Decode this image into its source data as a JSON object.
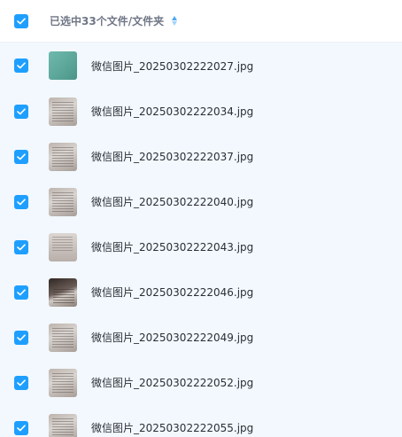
{
  "header": {
    "select_all_checked": true,
    "selection_label": "已选中33个文件/文件夹",
    "sort_icon": "sort-icon"
  },
  "files": [
    {
      "name": "微信图片_20250302222027.jpg",
      "checked": true,
      "thumb": "teal"
    },
    {
      "name": "微信图片_20250302222034.jpg",
      "checked": true,
      "thumb": "doc"
    },
    {
      "name": "微信图片_20250302222037.jpg",
      "checked": true,
      "thumb": "doc"
    },
    {
      "name": "微信图片_20250302222040.jpg",
      "checked": true,
      "thumb": "doc"
    },
    {
      "name": "微信图片_20250302222043.jpg",
      "checked": true,
      "thumb": "light"
    },
    {
      "name": "微信图片_20250302222046.jpg",
      "checked": true,
      "thumb": "dark"
    },
    {
      "name": "微信图片_20250302222049.jpg",
      "checked": true,
      "thumb": "doc"
    },
    {
      "name": "微信图片_20250302222052.jpg",
      "checked": true,
      "thumb": "doc"
    },
    {
      "name": "微信图片_20250302222055.jpg",
      "checked": true,
      "thumb": "doc"
    }
  ],
  "colors": {
    "accent": "#1e9fff",
    "list_background": "#f2f8fe",
    "header_text": "#6f7685",
    "file_text": "#2b2f36"
  }
}
